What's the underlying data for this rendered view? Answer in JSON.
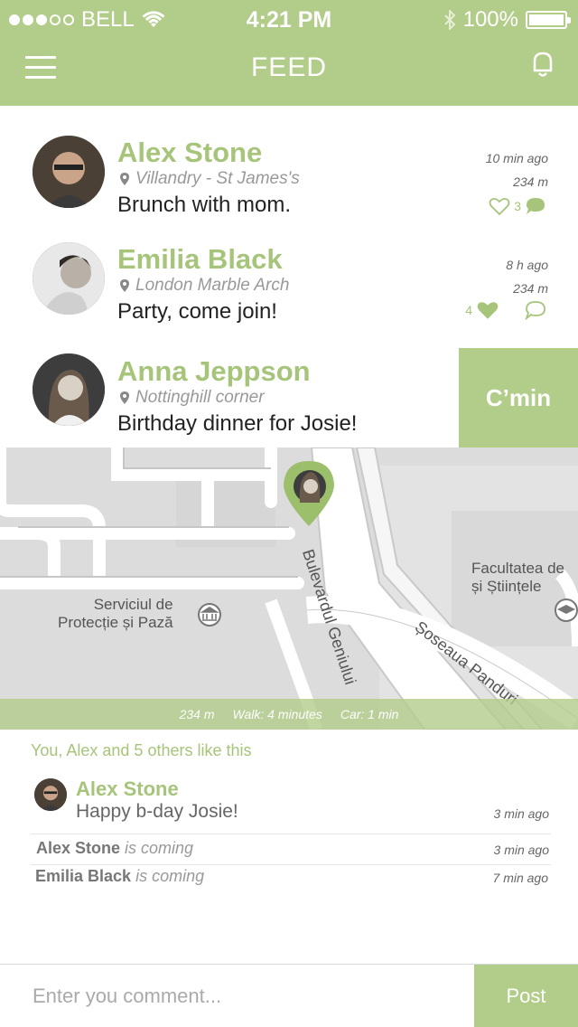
{
  "status_bar": {
    "carrier": "BELL",
    "time": "4:21 PM",
    "battery": "100%"
  },
  "header": {
    "title": "FEED"
  },
  "feed": [
    {
      "name": "Alex Stone",
      "location": "Villandry - St James's",
      "message": "Brunch with mom.",
      "time": "10 min ago",
      "distance": "234 m",
      "comments": "3"
    },
    {
      "name": "Emilia Black",
      "location": "London Marble Arch",
      "message": "Party, come join!",
      "time": "8 h ago",
      "distance": "234 m",
      "likes": "4"
    },
    {
      "name": "Anna Jeppson",
      "location": "Nottinghill corner",
      "message": "Birthday dinner for Josie!",
      "action": "C’min"
    }
  ],
  "map": {
    "labels": {
      "street1": "Bulevardul Geniului",
      "street2": "Șoseaua Panduri",
      "poi1": "Serviciul de\nProtecție și Pază",
      "poi2": "Facultatea de\nși Științele"
    },
    "info": {
      "distance": "234 m",
      "walk": "Walk: 4 minutes",
      "car": "Car: 1 min"
    }
  },
  "likes_text": "You, Alex and 5 others like this",
  "comments": [
    {
      "name": "Alex Stone",
      "text": "Happy b-day Josie!",
      "time": "3 min ago"
    }
  ],
  "coming": [
    {
      "name": "Alex Stone",
      "suffix": "is coming",
      "time": "3 min ago"
    },
    {
      "name": "Emilia Black",
      "suffix": "is coming",
      "time": "7 min ago"
    }
  ],
  "composer": {
    "placeholder": "Enter you comment...",
    "post_label": "Post"
  },
  "colors": {
    "accent": "#b2cc8a",
    "accent_text": "#a6c47a"
  }
}
